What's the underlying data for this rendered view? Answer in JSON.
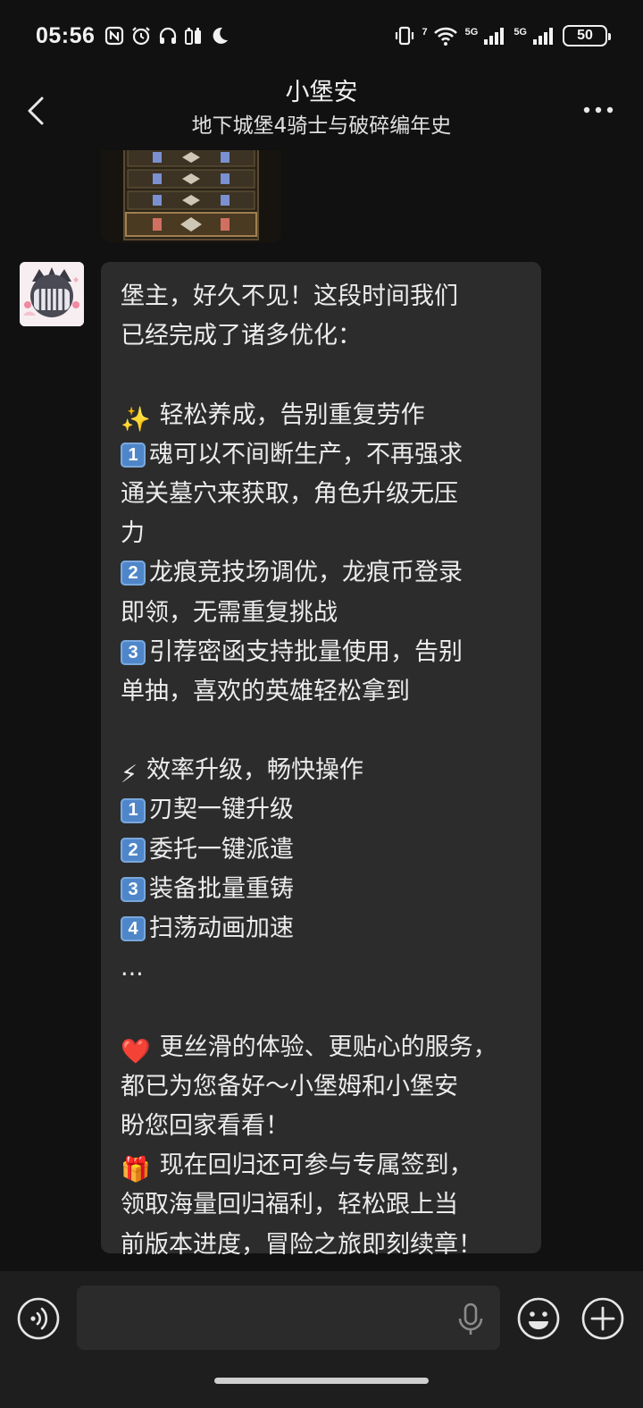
{
  "status_bar": {
    "time": "05:56",
    "icons": [
      "nfc-icon",
      "alarm-icon",
      "headphones-icon",
      "battery-saver-icon",
      "moon-icon"
    ],
    "network_label_1": "5G",
    "network_label_2": "5G",
    "wifi_label": "7",
    "battery": "50"
  },
  "header": {
    "title": "小堡安",
    "subtitle": "地下城堡4骑士与破碎编年史"
  },
  "message": {
    "lines": [
      {
        "text": "堡主，好久不见！这段时间我们"
      },
      {
        "text": "已经完成了诸多优化："
      },
      {
        "text": ""
      },
      {
        "emoji": "✨",
        "text": "轻松养成，告别重复劳作"
      },
      {
        "num": "1",
        "text": "魂可以不间断生产，不再强求"
      },
      {
        "text": "通关墓穴来获取，角色升级无压"
      },
      {
        "text": "力"
      },
      {
        "num": "2",
        "text": "龙痕竞技场调优，龙痕币登录"
      },
      {
        "text": "即领，无需重复挑战"
      },
      {
        "num": "3",
        "text": "引荐密函支持批量使用，告别"
      },
      {
        "text": "单抽，喜欢的英雄轻松拿到"
      },
      {
        "text": ""
      },
      {
        "emoji": "⚡",
        "text": "效率升级，畅快操作"
      },
      {
        "num": "1",
        "text": "刃契一键升级"
      },
      {
        "num": "2",
        "text": "委托一键派遣"
      },
      {
        "num": "3",
        "text": "装备批量重铸"
      },
      {
        "num": "4",
        "text": "扫荡动画加速"
      },
      {
        "text": "..."
      },
      {
        "text": ""
      },
      {
        "emoji": "❤️",
        "text": "更丝滑的体验、更贴心的服务，"
      },
      {
        "text": "都已为您备好～小堡姆和小堡安"
      },
      {
        "text": "盼您回家看看！"
      },
      {
        "emoji": "🎁",
        "text": "现在回归还可参与专属签到，"
      },
      {
        "text": "领取海量回归福利，轻松跟上当"
      },
      {
        "text": "前版本进度，冒险之旅即刻续章！"
      }
    ]
  },
  "input": {
    "value": "",
    "placeholder": ""
  },
  "colors": {
    "background": "#111111",
    "bubble": "#2c2c2c",
    "input_bar": "#1e1e1e",
    "keycap": "#4f86c9"
  }
}
